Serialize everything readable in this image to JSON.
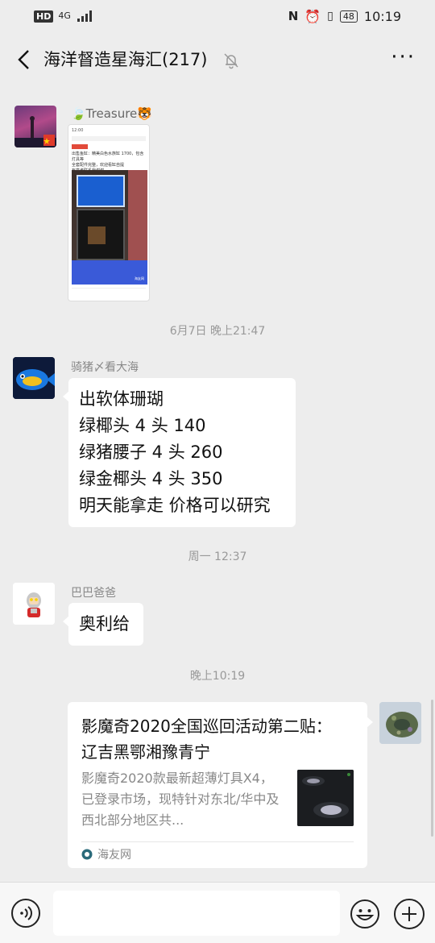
{
  "status_bar": {
    "hd": "HD",
    "network": "4G",
    "battery": "48",
    "time": "10:19"
  },
  "header": {
    "title": "海洋督造星海汇(217)",
    "back_icon": "chevron-left-icon",
    "mute_icon": "bell-off-icon",
    "more_label": "···"
  },
  "messages": [
    {
      "type": "image",
      "sender": "🍃Treasure🐯",
      "image_text": [
        "12:00",
        "出售鱼缸：精美白色水族缸 1700，包含灯具等",
        "全套配件完整，欢迎看缸自提",
        "有意者联系我谢谢",
        "海友网"
      ]
    },
    {
      "type": "time",
      "text": "6月7日 晚上21:47"
    },
    {
      "type": "text",
      "sender": "骑猪〆看大海",
      "lines": [
        "出软体珊瑚",
        "绿椰头 4 头 140",
        "绿猪腰子 4 头 260",
        "绿金椰头 4 头 350",
        "明天能拿走 价格可以研究"
      ]
    },
    {
      "type": "time",
      "text": "周一 12:37"
    },
    {
      "type": "text",
      "sender": "巴巴爸爸",
      "lines": [
        "奥利给"
      ]
    },
    {
      "type": "time",
      "text": "晚上10:19"
    },
    {
      "type": "link",
      "title": "影魔奇2020全国巡回活动第二贴： 辽吉黑鄂湘豫青宁",
      "desc": "影魔奇2020款最新超薄灯具X4，已登录市场，现特针对东北/华中及西北部分地区共...",
      "source": "海友网",
      "source_icon": "site-logo-icon"
    }
  ],
  "bottom_bar": {
    "voice_icon": "voice-icon",
    "emoji_icon": "emoji-icon",
    "plus_icon": "plus-icon",
    "input_value": ""
  }
}
